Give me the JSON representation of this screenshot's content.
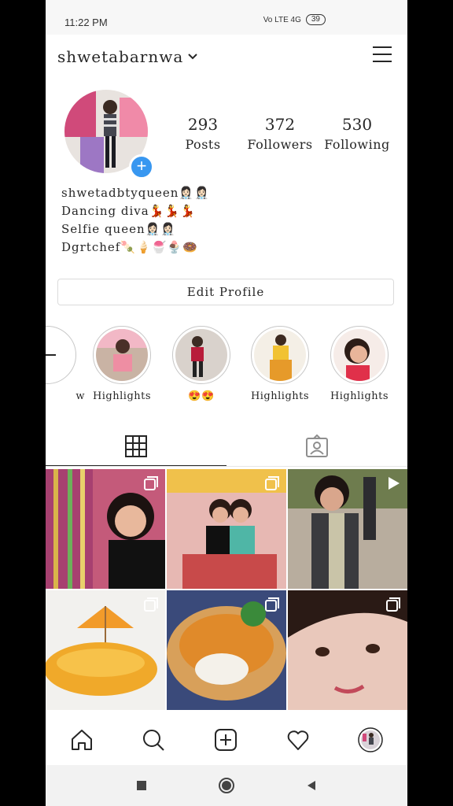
{
  "status_bar": {
    "time": "11:22 PM",
    "network": "Vo LTE 4G",
    "battery": "39"
  },
  "header": {
    "username": "shwetabarnwa"
  },
  "profile": {
    "stats": [
      {
        "value": "293",
        "label": "Posts"
      },
      {
        "value": "372",
        "label": "Followers"
      },
      {
        "value": "530",
        "label": "Following"
      }
    ],
    "bio": [
      "shwetadbtyqueen👩🏻‍⚕️👩🏻‍⚕️",
      "Dancing diva💃💃💃",
      "Selfie queen👩🏻‍⚕️👩🏻‍⚕️",
      "Dgrtchef🍡🍦🍧🍨🍩"
    ],
    "edit_button": "Edit Profile"
  },
  "highlights": [
    {
      "label": "w"
    },
    {
      "label": "Highlights"
    },
    {
      "label": "😍😍"
    },
    {
      "label": "Highlights"
    },
    {
      "label": "Highlights"
    }
  ],
  "tabs": [
    {
      "name": "grid",
      "icon": "grid-icon",
      "active": true
    },
    {
      "name": "tagged",
      "icon": "tagged-user-icon",
      "active": false
    }
  ],
  "posts": [
    {
      "icon": "multi-select-icon"
    },
    {
      "icon": "multi-select-icon"
    },
    {
      "icon": "reel-play-icon"
    },
    {
      "icon": "multi-select-icon"
    },
    {
      "icon": "multi-select-icon"
    },
    {
      "icon": "multi-select-icon"
    }
  ],
  "bottom_nav": [
    "home-icon",
    "search-icon",
    "new-post-icon",
    "activity-heart-icon",
    "profile-avatar-icon"
  ],
  "system_nav": [
    "recents-square-icon",
    "home-circle-icon",
    "back-triangle-icon"
  ],
  "colors": {
    "accent": "#3897f0",
    "text": "#262626",
    "border": "#dbdbdb"
  }
}
